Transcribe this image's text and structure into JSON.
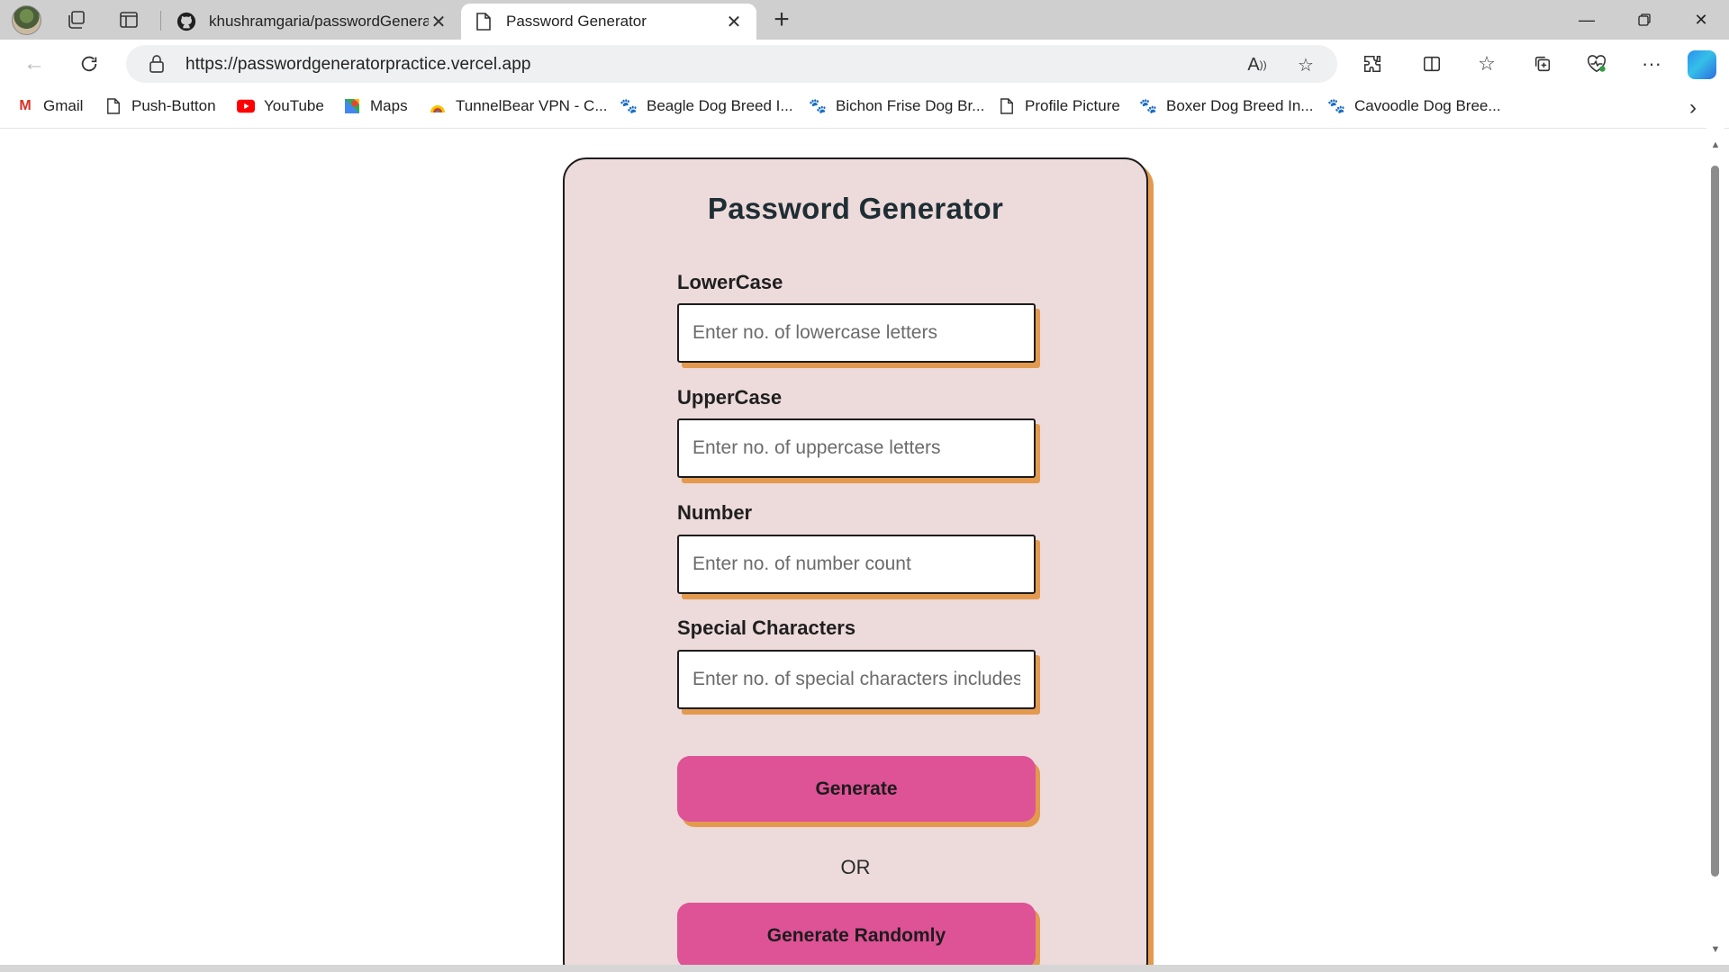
{
  "browser": {
    "tabs": [
      {
        "title": "khushramgaria/passwordGenerat",
        "active": false
      },
      {
        "title": "Password Generator",
        "active": true
      }
    ],
    "url": "https://passwordgeneratorpractice.vercel.app",
    "bookmarks": [
      "Gmail",
      "Push-Button",
      "YouTube",
      "Maps",
      "TunnelBear VPN - C...",
      "Beagle Dog Breed I...",
      "Bichon Frise Dog Br...",
      "Profile Picture",
      "Boxer Dog Breed In...",
      "Cavoodle Dog Bree..."
    ]
  },
  "app": {
    "title": "Password Generator",
    "fields": [
      {
        "label": "LowerCase",
        "placeholder": "Enter no. of lowercase letters",
        "value": ""
      },
      {
        "label": "UpperCase",
        "placeholder": "Enter no. of uppercase letters",
        "value": ""
      },
      {
        "label": "Number",
        "placeholder": "Enter no. of number count",
        "value": ""
      },
      {
        "label": "Special Characters",
        "placeholder": "Enter no. of special characters includes",
        "value": ""
      }
    ],
    "generate_label": "Generate",
    "or_label": "OR",
    "generate_random_label": "Generate Randomly"
  },
  "colors": {
    "card_background": "#eddada",
    "shadow_accent": "#e39a4f",
    "button_pink": "#de5296",
    "title_color": "#1e2e34"
  }
}
